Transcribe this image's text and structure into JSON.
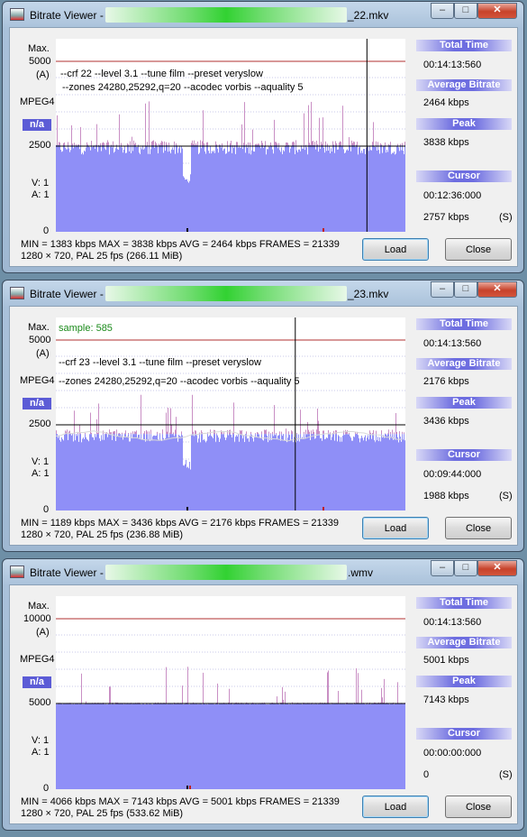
{
  "windows": [
    {
      "title_prefix": "Bitrate Viewer - ",
      "title_suffix": "_22.mkv",
      "max_label": "Max.",
      "max_value": "5000",
      "avg_mode": "(A)",
      "codec": "MPEG4",
      "na_badge": "n/a",
      "mid_value": "2500",
      "v_label": "V:  1",
      "a_label": "A:  1",
      "zero": "0",
      "sample_text": "",
      "note_line1": "--crf 22  --level 3.1 --tune film --preset veryslow",
      "note_line2": "--zones 24280,25292,q=20 --acodec vorbis  --aquality 5",
      "total_time_title": "Total Time",
      "total_time": "00:14:13:560",
      "avg_bitrate_title": "Average Bitrate",
      "avg_bitrate": "2464 kbps",
      "peak_title": "Peak",
      "peak": "3838 kbps",
      "cursor_title": "Cursor",
      "cursor_time": "00:12:36:000",
      "cursor_bitrate": "2757 kbps",
      "cursor_unit": "(S)",
      "stats_line1": "MIN = 1383 kbps  MAX = 3838 kbps  AVG = 2464 kbps  FRAMES = 21339",
      "stats_line2": "1280 × 720, PAL 25 fps  (266.11 MiB)",
      "load_label": "Load",
      "close_label": "Close",
      "graph": {
        "max": 5000,
        "avg": 2464,
        "peak": 3838,
        "min": 1383,
        "cursor_frac": 0.89,
        "fill_color": "#8f8ff7",
        "spike_color": "#c98fc4",
        "show_avg_curve": false,
        "noise": 420
      }
    },
    {
      "title_prefix": "Bitrate Viewer - ",
      "title_suffix": "_23.mkv",
      "max_label": "Max.",
      "max_value": "5000",
      "avg_mode": "(A)",
      "codec": "MPEG4",
      "na_badge": "n/a",
      "mid_value": "2500",
      "v_label": "V:  1",
      "a_label": "A:  1",
      "zero": "0",
      "sample_text": "sample: 585",
      "note_line1": "--crf 23  --level 3.1 --tune film --preset veryslow",
      "note_line2": "--zones 24280,25292,q=20 --acodec vorbis  --aquality 5",
      "total_time_title": "Total Time",
      "total_time": "00:14:13:560",
      "avg_bitrate_title": "Average Bitrate",
      "avg_bitrate": "2176 kbps",
      "peak_title": "Peak",
      "peak": "3436 kbps",
      "cursor_title": "Cursor",
      "cursor_time": "00:09:44:000",
      "cursor_bitrate": "1988 kbps",
      "cursor_unit": "(S)",
      "stats_line1": "MIN = 1189 kbps  MAX = 3436 kbps  AVG = 2176 kbps  FRAMES = 21339",
      "stats_line2": "1280 × 720, PAL 25 fps  (236.88 MiB)",
      "load_label": "Load",
      "close_label": "Close",
      "graph": {
        "max": 5000,
        "avg": 2176,
        "peak": 3436,
        "min": 1189,
        "cursor_frac": 0.685,
        "fill_color": "#8f8ff7",
        "spike_color": "#c98fc4",
        "show_avg_curve": true,
        "noise": 380
      }
    },
    {
      "title_prefix": "Bitrate Viewer - ",
      "title_suffix": ".wmv",
      "max_label": "Max.",
      "max_value": "10000",
      "avg_mode": "(A)",
      "codec": "MPEG4",
      "na_badge": "n/a",
      "mid_value": "5000",
      "v_label": "V:  1",
      "a_label": "A:  1",
      "zero": "0",
      "sample_text": "",
      "note_line1": "",
      "note_line2": "",
      "total_time_title": "Total Time",
      "total_time": "00:14:13:560",
      "avg_bitrate_title": "Average Bitrate",
      "avg_bitrate": "5001 kbps",
      "peak_title": "Peak",
      "peak": "7143 kbps",
      "cursor_title": "Cursor",
      "cursor_time": "00:00:00:000",
      "cursor_bitrate": "0",
      "cursor_unit": "(S)",
      "stats_line1": "MIN = 4066 kbps  MAX = 7143 kbps  AVG = 5001 kbps  FRAMES = 21339",
      "stats_line2": "1280 × 720, PAL 25 fps  (533.62 MiB)",
      "load_label": "Load",
      "close_label": "Close",
      "graph": {
        "max": 10000,
        "avg": 5001,
        "peak": 7143,
        "min": 4066,
        "cursor_frac": null,
        "fill_color": "#8f8ff7",
        "spike_color": "#c98fc4",
        "show_avg_curve": false,
        "noise": 120
      }
    }
  ]
}
